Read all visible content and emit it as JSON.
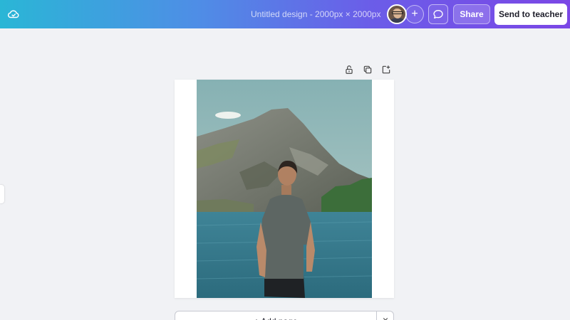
{
  "topbar": {
    "title": "Untitled design - 2000px × 2000px",
    "add_collaborator_label": "+",
    "share_label": "Share",
    "send_label": "Send to teacher"
  },
  "canvas": {
    "add_page_label": "+ Add page"
  },
  "icons": {
    "cloud": "cloud-check-icon",
    "comment": "comment-icon",
    "lock": "unlock-icon",
    "duplicate": "duplicate-icon",
    "add_page": "add-page-icon",
    "chevron": "chevron-down-icon"
  },
  "colors": {
    "gradient_start": "#2ab6d6",
    "gradient_end": "#7b47e6",
    "workspace": "#f1f2f5"
  }
}
